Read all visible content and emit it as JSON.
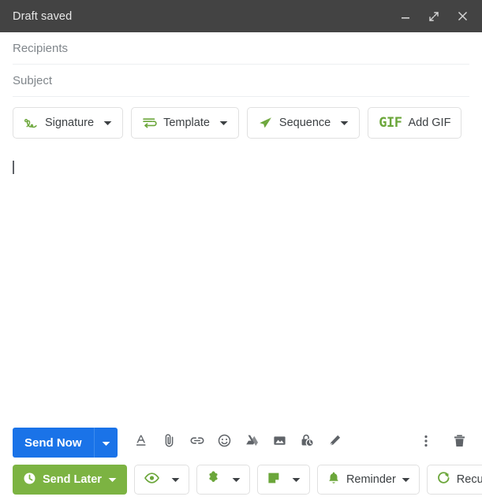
{
  "window": {
    "title": "Draft saved",
    "controls": [
      {
        "name": "minimize-button",
        "icon": "minimize-icon",
        "label": "Minimize"
      },
      {
        "name": "expand-button",
        "icon": "expand-icon",
        "label": "Full screen"
      },
      {
        "name": "close-button",
        "icon": "close-icon",
        "label": "Close"
      }
    ]
  },
  "fields": {
    "recipients": {
      "placeholder": "Recipients",
      "value": ""
    },
    "subject": {
      "placeholder": "Subject",
      "value": ""
    }
  },
  "toolbar": {
    "chips": [
      {
        "label": "Signature",
        "icon": "signature-squiggle-icon",
        "caret": true
      },
      {
        "label": "Template",
        "icon": "template-icon",
        "caret": true
      },
      {
        "label": "Sequence",
        "icon": "paper-plane-icon",
        "caret": true
      },
      {
        "label": "Add GIF",
        "icon": "gif-logo-icon",
        "caret": false,
        "logo_text": "GIF"
      }
    ]
  },
  "body": {
    "content": "",
    "caret_visible": true
  },
  "actions": {
    "send_now": {
      "label": "Send Now",
      "caret": true
    },
    "icons": [
      {
        "name": "format-text-icon",
        "title": "Formatting options"
      },
      {
        "name": "attach-file-icon",
        "title": "Attach files"
      },
      {
        "name": "insert-link-icon",
        "title": "Insert link"
      },
      {
        "name": "insert-emoji-icon",
        "title": "Insert emoji"
      },
      {
        "name": "google-drive-icon",
        "title": "Insert files using Drive"
      },
      {
        "name": "insert-photo-icon",
        "title": "Insert photo"
      },
      {
        "name": "confidential-mode-icon",
        "title": "Toggle confidential mode"
      },
      {
        "name": "insert-signature-pen-icon",
        "title": "Insert signature"
      }
    ],
    "right_icons": [
      {
        "name": "more-options-icon",
        "title": "More options"
      },
      {
        "name": "discard-draft-icon",
        "title": "Discard draft"
      }
    ]
  },
  "bottom": {
    "send_later": {
      "label": "Send Later",
      "icon": "clock-icon",
      "caret": true
    },
    "chips": [
      {
        "label": "",
        "icon": "eye-tracking-icon",
        "caret": true
      },
      {
        "label": "",
        "icon": "puzzle-piece-icon",
        "caret": true
      },
      {
        "label": "",
        "icon": "sticky-note-icon",
        "caret": true
      },
      {
        "label": "Reminder",
        "icon": "bell-icon",
        "caret": true
      },
      {
        "label": "Recurring",
        "icon": "recurring-arrow-icon",
        "caret": true
      }
    ]
  },
  "colors": {
    "header_bg": "#434343",
    "accent_blue": "#1a73e8",
    "accent_green": "#7cb342",
    "icon_green": "#6ba63a",
    "icon_gray": "#5f6368",
    "border": "#e0e0e0"
  }
}
